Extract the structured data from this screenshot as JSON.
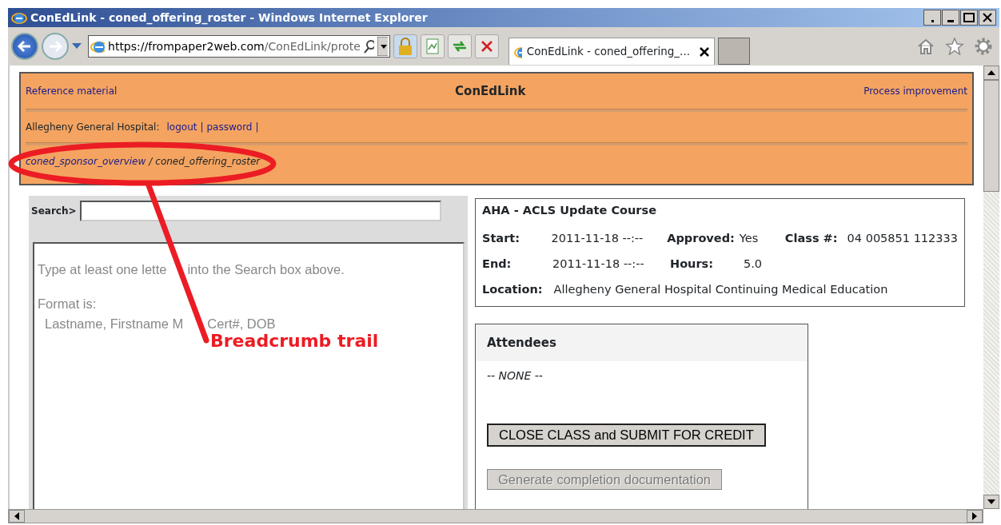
{
  "window": {
    "title": "ConEdLink - coned_offering_roster - Windows Internet Explorer"
  },
  "address_bar": {
    "host": "https://frompaper2web.com",
    "path": "/ConEdLink/prote"
  },
  "tabs": [
    {
      "label": "ConEdLink - coned_offering_...",
      "selected": true
    }
  ],
  "header": {
    "left_link": "Reference material",
    "title": "ConEdLink",
    "right_link": "Process improvement",
    "organization": "Allegheny General Hospital:",
    "user_links": [
      {
        "label": "logout",
        "separator": "|"
      },
      {
        "label": "password",
        "separator": "|"
      }
    ],
    "breadcrumb": [
      {
        "label": "coned_sponsor_overview",
        "kind": "link"
      },
      {
        "label": "/",
        "kind": "separator"
      },
      {
        "label": "coned_offering_roster",
        "kind": "current"
      }
    ]
  },
  "search": {
    "label": "Search>",
    "help": [
      [
        "Type at least one lette",
        "into the Search box above."
      ],
      [
        "Format is:"
      ],
      [
        "Lastname, Firstname M",
        "Cert#, DOB"
      ]
    ]
  },
  "course": {
    "title": "AHA - ACLS Update Course",
    "rows": [
      [
        {
          "label": "Start:",
          "value": "2011-11-18 --:--"
        },
        {
          "label": "Approved:",
          "value": "Yes"
        },
        {
          "label": "Class #:",
          "value": "04 005851 112333"
        }
      ],
      [
        {
          "label": "End:",
          "value": "2011-11-18 --:--"
        },
        {
          "label": "Hours:",
          "value": "5.0"
        }
      ],
      [
        {
          "label": "Location:",
          "value": "Allegheny General Hospital Continuing Medical Education"
        }
      ]
    ]
  },
  "attendees": {
    "title": "Attendees",
    "empty_text": "-- NONE --",
    "buttons": [
      {
        "label": "CLOSE CLASS and SUBMIT FOR CREDIT",
        "disabled": false
      },
      {
        "label": "Generate completion documentation",
        "disabled": true
      }
    ]
  },
  "annotation": {
    "text": "Breadcrumb trail"
  }
}
